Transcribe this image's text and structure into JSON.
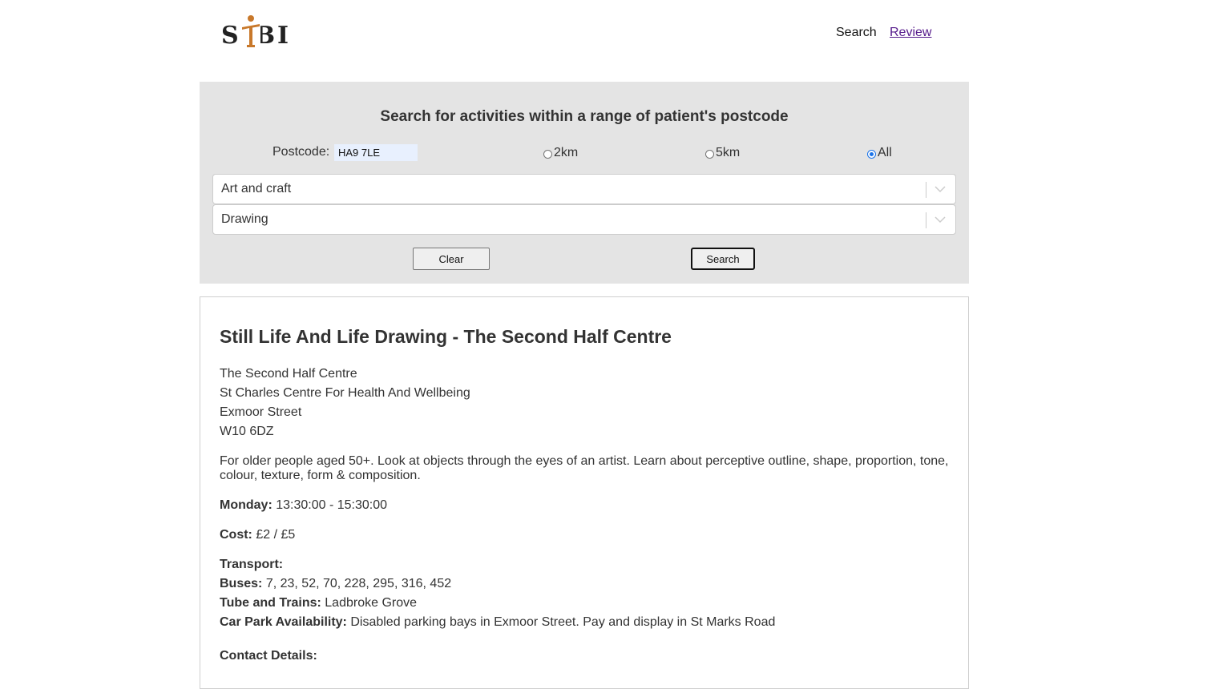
{
  "header": {
    "logo_text": "SIBI",
    "nav": {
      "search": "Search",
      "review": "Review"
    }
  },
  "search_panel": {
    "title": "Search for activities within a range of patient's postcode",
    "postcode_label": "Postcode:",
    "postcode_value": "HA9 7LE",
    "radius_options": [
      {
        "label": "2km",
        "selected": false
      },
      {
        "label": "5km",
        "selected": false
      },
      {
        "label": "All",
        "selected": true
      }
    ],
    "category_select": "Art and craft",
    "subcategory_select": "Drawing",
    "clear_label": "Clear",
    "search_label": "Search"
  },
  "result": {
    "title": "Still Life And Life Drawing - The Second Half Centre",
    "address": [
      "The Second Half Centre",
      "St Charles Centre For Health And Wellbeing",
      "Exmoor Street",
      "W10 6DZ"
    ],
    "description": "For older people aged 50+. Look at objects through the eyes of an artist. Learn about perceptive outline, shape, proportion, tone, colour, texture, form & composition.",
    "schedule_label": "Monday:",
    "schedule_value": "13:30:00 - 15:30:00",
    "cost_label": "Cost:",
    "cost_value": "£2 / £5",
    "transport_label": "Transport:",
    "buses_label": "Buses:",
    "buses_value": "7, 23, 52, 70, 228, 295, 316, 452",
    "tube_label": "Tube and Trains:",
    "tube_value": "Ladbroke Grove",
    "carpark_label": "Car Park Availability:",
    "carpark_value": "Disabled parking bays in Exmoor Street. Pay and display in St Marks Road",
    "contact_label": "Contact Details:"
  },
  "colors": {
    "panel_bg": "#e4e4e4",
    "logo_accent": "#c8782a",
    "link_visited": "#551a8b",
    "radio_selected": "#1a73e8"
  },
  "icons": [
    "logo-figure-icon",
    "chevron-down-icon"
  ]
}
